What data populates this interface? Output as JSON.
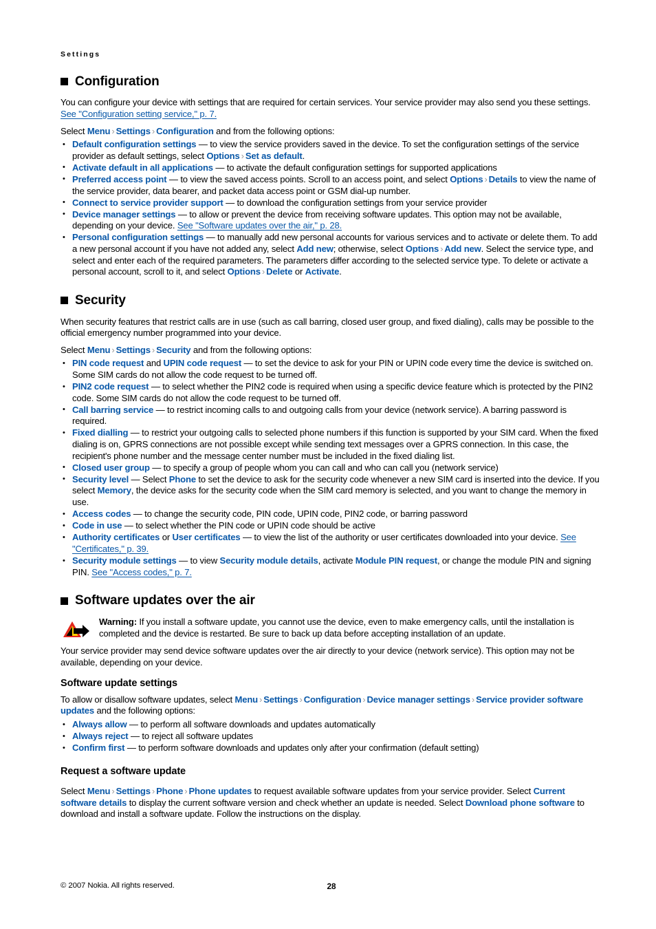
{
  "running_head": "Settings",
  "colors": {
    "link": "#0a58a8",
    "arrow": "#9b9b9b",
    "text": "#000000",
    "warn_triangle_outer": "#e1261c",
    "warn_triangle_inner": "#ffd200",
    "warn_arrow": "#000000"
  },
  "icons": {
    "section_bullet": "black-square-icon",
    "list_bullet": "bullet-dot-icon",
    "breadcrumb_arrow": "chevron-right-icon",
    "warning": "warning-triangle-arrow-icon"
  },
  "sections": {
    "configuration": {
      "heading": "Configuration",
      "intro_1": "You can configure your device with settings that are required for certain services. Your service provider may also send you these settings. ",
      "intro_1_xref": "See \"Configuration setting service,\" p. 7.",
      "select_prefix": "Select ",
      "path": [
        "Menu",
        "Settings",
        "Configuration"
      ],
      "select_suffix": " and from the following options:",
      "items": [
        {
          "term": "Default configuration settings",
          "desc_a": " — to view the service providers saved in the device. To set the configuration settings of the service provider as default settings, select ",
          "inline_path": [
            "Options",
            "Set as default"
          ],
          "desc_b": "."
        },
        {
          "term": "Activate default in all applications",
          "desc_a": " — to activate the default configuration settings for supported applications"
        },
        {
          "term": "Preferred access point",
          "desc_a": " — to view the saved access points. Scroll to an access point, and select ",
          "inline_path": [
            "Options",
            "Details"
          ],
          "desc_b": " to view the name of the service provider, data bearer, and packet data access point or GSM dial-up number."
        },
        {
          "term": "Connect to service provider support",
          "desc_a": " — to download the configuration settings from your service provider"
        },
        {
          "term": "Device manager settings",
          "desc_a": " — to allow or prevent the device from receiving software updates. This option may not be available, depending on your device. ",
          "xref": "See \"Software updates over the air,\" p. 28."
        },
        {
          "term": "Personal configuration settings",
          "desc_a": " — to manually add new personal accounts for various services and to activate or delete them. To add a new personal account if you have not added any, select ",
          "ui_1": "Add new",
          "desc_b": "; otherwise, select ",
          "inline_path": [
            "Options",
            "Add new"
          ],
          "desc_c": ". Select the service type, and select and enter each of the required parameters. The parameters differ according to the selected service type. To delete or activate a personal account, scroll to it, and select ",
          "inline_path_2": [
            "Options",
            "Delete"
          ],
          "desc_d": " or ",
          "ui_2": "Activate",
          "desc_e": "."
        }
      ]
    },
    "security": {
      "heading": "Security",
      "intro": "When security features that restrict calls are in use (such as call barring, closed user group, and fixed dialing), calls may be possible to the official emergency number programmed into your device.",
      "select_prefix": "Select ",
      "path": [
        "Menu",
        "Settings",
        "Security"
      ],
      "select_suffix": " and from the following options:",
      "items": [
        {
          "term": "PIN code request",
          "mid": " and ",
          "term2": "UPIN code request",
          "desc_a": " — to set the device to ask for your PIN or UPIN code every time the device is switched on. Some SIM cards do not allow the code request to be turned off."
        },
        {
          "term": "PIN2 code request",
          "desc_a": " — to select whether the PIN2 code is required when using a specific device feature which is protected by the PIN2 code. Some SIM cards do not allow the code request to be turned off."
        },
        {
          "term": "Call barring service",
          "desc_a": " — to restrict incoming calls to and outgoing calls from your device (network service). A barring password is required."
        },
        {
          "term": "Fixed dialling",
          "desc_a": " — to restrict your outgoing calls to selected phone numbers if this function is supported by your SIM card. When the fixed dialing is on, GPRS connections are not possible except while sending text messages over a GPRS connection. In this case, the recipient's phone number and the message center number must be included in the fixed dialing list."
        },
        {
          "term": "Closed user group",
          "desc_a": " — to specify a group of people whom you can call and who can call you (network service)"
        },
        {
          "term": "Security level",
          "desc_a": " — Select ",
          "ui_1": "Phone",
          "desc_b": " to set the device to ask for the security code whenever a new SIM card is inserted into the device. If you select ",
          "ui_2": "Memory",
          "desc_c": ", the device asks for the security code when the SIM card memory is selected, and you want to change the memory in use."
        },
        {
          "term": "Access codes",
          "desc_a": " — to change the security code, PIN code, UPIN code, PIN2 code, or barring password"
        },
        {
          "term": "Code in use",
          "desc_a": " — to select whether the PIN code or UPIN code should be active"
        },
        {
          "term": "Authority certificates",
          "mid": " or ",
          "term2": "User certificates",
          "desc_a": " — to view the list of the authority or user certificates downloaded into your device. ",
          "xref": "See \"Certificates,\" p. 39."
        },
        {
          "term": "Security module settings",
          "desc_a": " — to view ",
          "ui_1": "Security module details",
          "desc_b": ", activate ",
          "ui_2": "Module PIN request",
          "desc_c": ", or change the module PIN and signing PIN. ",
          "xref": "See \"Access codes,\" p. 7."
        }
      ]
    },
    "software_updates": {
      "heading": "Software updates over the air",
      "warning_label": "Warning:",
      "warning_text": " If you install a software update, you cannot use the device, even to make emergency calls, until the installation is completed and the device is restarted. Be sure to back up data before accepting installation of an update.",
      "body": "Your service provider may send device software updates over the air directly to your device (network service). This option may not be available, depending on your device.",
      "settings": {
        "heading": "Software update settings",
        "intro_prefix": "To allow or disallow software updates, select ",
        "path": [
          "Menu",
          "Settings",
          "Configuration",
          "Device manager settings",
          "Service provider software updates"
        ],
        "intro_suffix": " and the following options:",
        "items": [
          {
            "term": "Always allow",
            "desc_a": " — to perform all software downloads and updates automatically"
          },
          {
            "term": "Always reject",
            "desc_a": " — to reject all software updates"
          },
          {
            "term": "Confirm first",
            "desc_a": " — to perform software downloads and updates only after your confirmation (default setting)"
          }
        ]
      },
      "request": {
        "heading": "Request a software update",
        "p_prefix": "Select ",
        "path": [
          "Menu",
          "Settings",
          "Phone",
          "Phone updates"
        ],
        "p_mid_1": " to request available software updates from your service provider. Select ",
        "ui_1": "Current software details",
        "p_mid_2": " to display the current software version and check whether an update is needed. Select ",
        "ui_2": "Download phone software",
        "p_end": " to download and install a software update. Follow the instructions on the display."
      }
    }
  },
  "footer": {
    "copyright": "© 2007 Nokia. All rights reserved.",
    "page_number": "28"
  }
}
